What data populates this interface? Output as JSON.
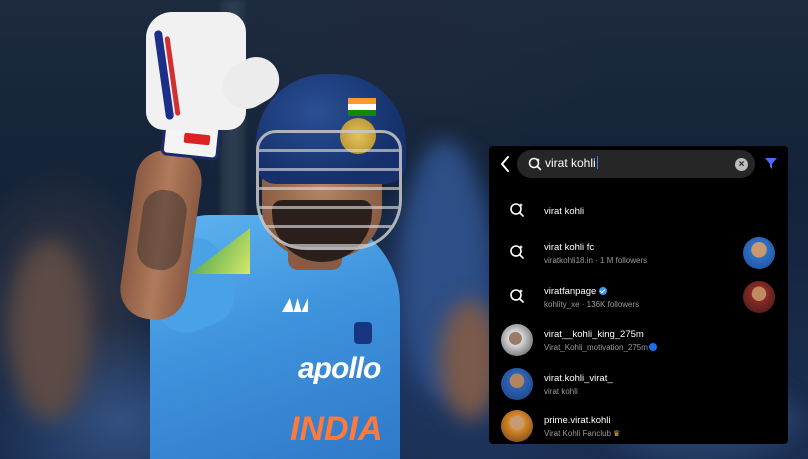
{
  "search": {
    "query": "virat kohli"
  },
  "results": [
    {
      "kind": "query",
      "title": "virat kohli",
      "subtitle": ""
    },
    {
      "kind": "account-query",
      "title": "virat kohli fc",
      "subtitle": "viratkohli18.in · 1 M followers"
    },
    {
      "kind": "account-query",
      "title": "viratfanpage",
      "subtitle": "kohlity_xe · 136K followers",
      "verified": true
    },
    {
      "kind": "account",
      "title": "virat__kohli_king_275m",
      "subtitle": "Virat_Kohli_motivation_275m"
    },
    {
      "kind": "account",
      "title": "virat.kohli_virat_",
      "subtitle": "virat kohli"
    },
    {
      "kind": "account",
      "title": "prime.virat.kohli",
      "subtitle": "Virat Kohli Fanclub"
    }
  ],
  "photo": {
    "sponsor_text": "apollo",
    "team_text": "INDIA"
  },
  "colors": {
    "panel_bg": "#000000",
    "search_bg": "#262626",
    "accent": "#3897f0",
    "jersey": "#3f93dd"
  },
  "icons": [
    "back-chevron-icon",
    "search-icon",
    "clear-icon",
    "filter-icon",
    "query-search-icon",
    "verified-icon"
  ]
}
